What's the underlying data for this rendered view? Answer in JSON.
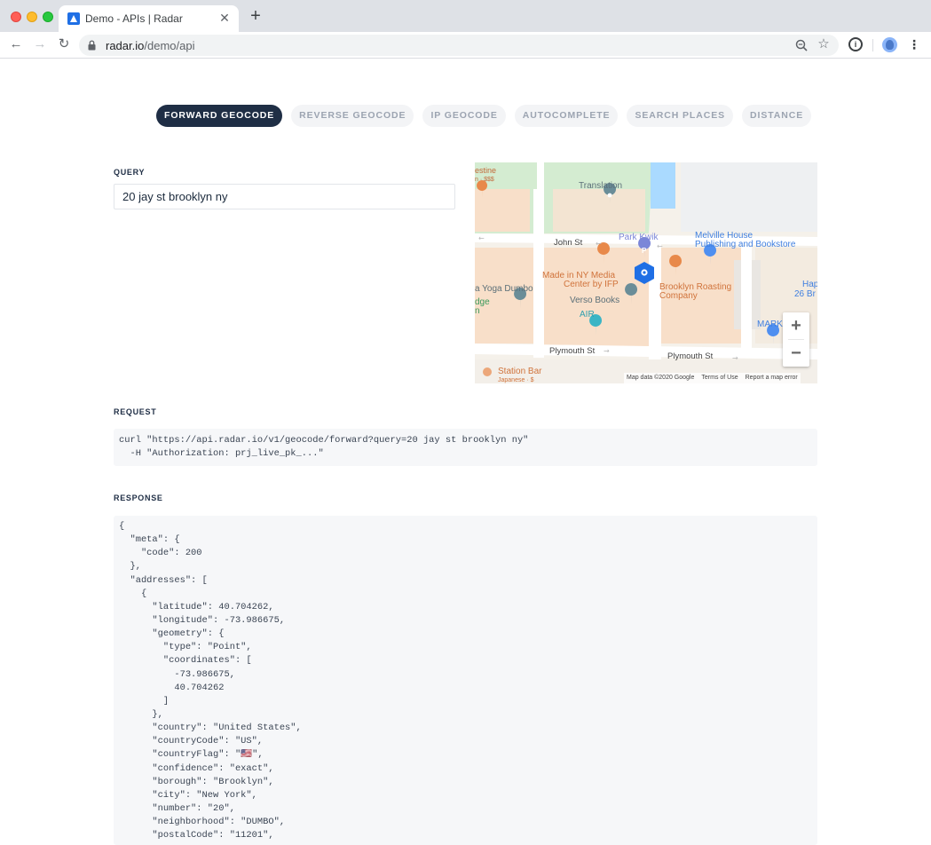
{
  "browser": {
    "tab_title": "Demo - APIs | Radar",
    "url_host": "radar.io",
    "url_path": "/demo/api"
  },
  "nav_tabs": [
    {
      "label": "FORWARD GEOCODE",
      "active": true
    },
    {
      "label": "REVERSE GEOCODE",
      "active": false
    },
    {
      "label": "IP GEOCODE",
      "active": false
    },
    {
      "label": "AUTOCOMPLETE",
      "active": false
    },
    {
      "label": "SEARCH PLACES",
      "active": false
    },
    {
      "label": "DISTANCE",
      "active": false
    }
  ],
  "query": {
    "label": "QUERY",
    "value": "20 jay st brooklyn ny"
  },
  "map": {
    "labels": {
      "translation": "Translation",
      "john_st": "John St",
      "park_kwik": "Park Kwik",
      "melville_1": "Melville House",
      "melville_2": "Publishing and Bookstore",
      "made_in_ny_1": "Made in NY Media",
      "made_in_ny_2": "Center by IFP",
      "yoga": "a Yoga Dumbo",
      "edge": "dge",
      "n": "n",
      "verso": "Verso Books",
      "brooklyn_roasting_1": "Brooklyn Roasting",
      "brooklyn_roasting_2": "Company",
      "air": "AIR",
      "hap": "Hap",
      "br": "26 Br",
      "mark": "MARK",
      "plymouth_1": "Plymouth St",
      "plymouth_2": "Plymouth St",
      "estine": "estine",
      "sss": "n · $$$",
      "station_bar": "Station Bar",
      "japanese": "Japanese · $"
    },
    "zoom_in": "+",
    "zoom_out": "−",
    "attribution": {
      "data": "Map data ©2020 Google",
      "terms": "Terms of Use",
      "report": "Report a map error"
    }
  },
  "request": {
    "label": "REQUEST",
    "lines": [
      "curl \"https://api.radar.io/v1/geocode/forward?query=20 jay st brooklyn ny\"",
      "  -H \"Authorization: prj_live_pk_...\""
    ]
  },
  "response": {
    "label": "RESPONSE",
    "lines": [
      "{",
      "  \"meta\": {",
      "    \"code\": 200",
      "  },",
      "  \"addresses\": [",
      "    {",
      "      \"latitude\": 40.704262,",
      "      \"longitude\": -73.986675,",
      "      \"geometry\": {",
      "        \"type\": \"Point\",",
      "        \"coordinates\": [",
      "          -73.986675,",
      "          40.704262",
      "        ]",
      "      },",
      "      \"country\": \"United States\",",
      "      \"countryCode\": \"US\",",
      "      \"countryFlag\": \"🇺🇸\",",
      "      \"confidence\": \"exact\",",
      "      \"borough\": \"Brooklyn\",",
      "      \"city\": \"New York\",",
      "      \"number\": \"20\",",
      "      \"neighborhood\": \"DUMBO\",",
      "      \"postalCode\": \"11201\","
    ]
  },
  "colors": {
    "active_tab": "#1f2e45",
    "marker": "#1f6fe5",
    "food_poi": "#e8894a",
    "park_poi": "#7b86d8"
  }
}
